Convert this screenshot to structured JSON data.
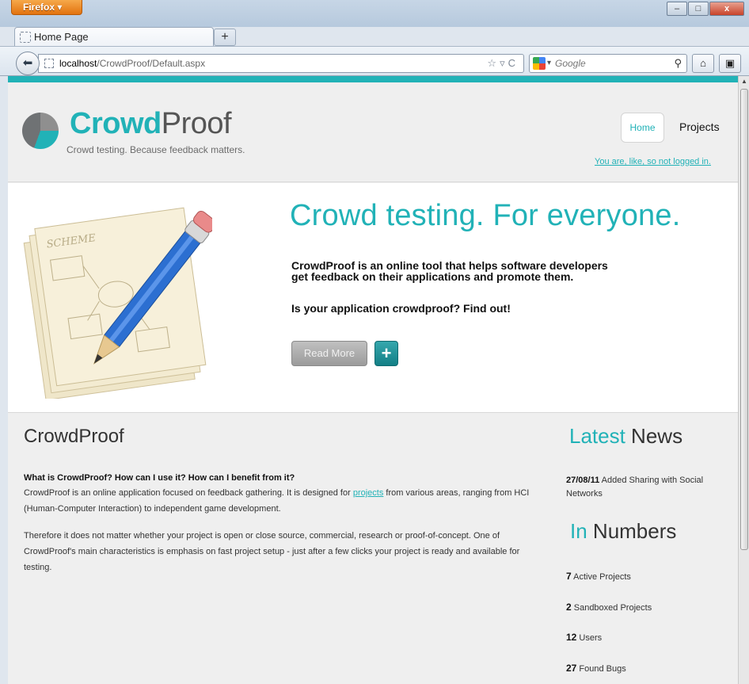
{
  "browser": {
    "app_button": "Firefox",
    "tab_title": "Home Page",
    "url_host": "localhost",
    "url_path": "/CrowdProof/Default.aspx",
    "search_placeholder": "Google",
    "window_controls": [
      "–",
      "□",
      "x"
    ]
  },
  "header": {
    "brand_bold": "Crowd",
    "brand_light": "Proof",
    "tagline": "Crowd testing. Because feedback matters.",
    "nav": {
      "home": "Home",
      "projects": "Projects"
    },
    "login_status": "You are, like, so not logged in."
  },
  "hero": {
    "art_label": "SCHEME",
    "title": "Crowd testing. For everyone.",
    "text_line1": "CrowdProof is an online tool that helps software developers",
    "text_line2": "get feedback on their applications and promote them.",
    "cta": "Is your application crowdproof? Find out!",
    "read_more": "Read More",
    "plus": "+"
  },
  "about": {
    "title": "CrowdProof",
    "question": "What is CrowdProof? How can I use it? How can I benefit from it?",
    "p1_before": "CrowdProof is an online application focused on feedback gathering. It is designed for ",
    "p1_link": "projects",
    "p1_after": " from various areas, ranging from HCI (Human-Computer Interaction) to independent game development.",
    "p2": "Therefore it does not matter whether your project is open or close source, commercial, research or proof-of-concept. One of CrowdProof's main characteristics is emphasis on fast project setup - just after a few clicks your project is ready and available for testing."
  },
  "news": {
    "title_accent": "Latest",
    "title_rest": " News",
    "item_date": "27/08/11",
    "item_text": " Added Sharing with Social Networks"
  },
  "numbers": {
    "title_accent": "In",
    "title_rest": " Numbers",
    "rows": [
      {
        "count": "7",
        "label": " Active Projects"
      },
      {
        "count": "2",
        "label": " Sandboxed Projects"
      },
      {
        "count": "12",
        "label": " Users"
      },
      {
        "count": "27",
        "label": " Found Bugs"
      }
    ]
  },
  "colors": {
    "accent": "#21b2b7",
    "page_bg": "#efefef"
  }
}
